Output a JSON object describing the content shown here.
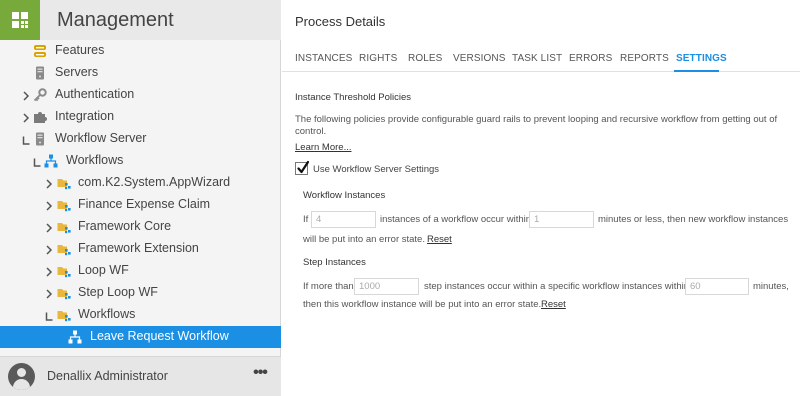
{
  "sidebar": {
    "title": "Management",
    "tree": [
      {
        "label": "Features",
        "chev": "",
        "icon": "features-icon"
      },
      {
        "label": "Servers",
        "chev": "",
        "icon": "server-icon"
      },
      {
        "label": "Authentication",
        "chev": ">",
        "icon": "key-icon"
      },
      {
        "label": "Integration",
        "chev": ">",
        "icon": "puzzle-icon"
      },
      {
        "label": "Workflow Server",
        "chev": "down",
        "icon": "server-icon"
      },
      {
        "label": "Workflows",
        "chev": "down",
        "icon": "workflow-icon"
      },
      {
        "label": "com.K2.System.AppWizard",
        "chev": ">",
        "icon": "folder-icon"
      },
      {
        "label": "Finance Expense Claim",
        "chev": ">",
        "icon": "folder-icon"
      },
      {
        "label": "Framework Core",
        "chev": ">",
        "icon": "folder-icon"
      },
      {
        "label": "Framework Extension",
        "chev": ">",
        "icon": "folder-icon"
      },
      {
        "label": "Loop WF",
        "chev": ">",
        "icon": "folder-icon"
      },
      {
        "label": "Step Loop WF",
        "chev": ">",
        "icon": "folder-icon"
      },
      {
        "label": "Workflows",
        "chev": "down",
        "icon": "folder-icon"
      },
      {
        "label": "Leave Request Workflow",
        "chev": "",
        "icon": "workflow-icon"
      }
    ],
    "footer": {
      "user_name": "Denallix Administrator",
      "more_label": "•••"
    }
  },
  "main": {
    "title": "Process Details",
    "tabs": [
      "INSTANCES",
      "RIGHTS",
      "ROLES",
      "VERSIONS",
      "TASK LIST",
      "ERRORS",
      "REPORTS",
      "SETTINGS"
    ],
    "active_tab": "SETTINGS",
    "section_title": "Instance Threshold Policies",
    "description": "The following policies provide configurable guard rails to prevent looping and recursive workflow from getting out of control.",
    "learn_more": "Learn More...",
    "use_server_settings": {
      "label": "Use Workflow Server Settings",
      "checked": true
    },
    "workflow_instances": {
      "title": "Workflow Instances",
      "text_if": "If",
      "instances_value": "4",
      "text_mid": "instances of a workflow occur within",
      "minutes_value": "1",
      "text_after": "minutes or less, then new workflow instances",
      "text_line2": "will be put into an error state.",
      "reset": "Reset"
    },
    "step_instances": {
      "title": "Step Instances",
      "text_if": "If more than",
      "step_value": "1000",
      "text_mid": "step instances occur within a specific workflow instances within",
      "minutes_value": "60",
      "text_after": "minutes,",
      "text_line2": "then this workflow instance will be put into an error state.",
      "reset": "Reset"
    }
  },
  "colors": {
    "brand_green": "#78a93b",
    "accent_blue": "#1a8fe3",
    "sidebar_bg": "#f4f4f4"
  }
}
